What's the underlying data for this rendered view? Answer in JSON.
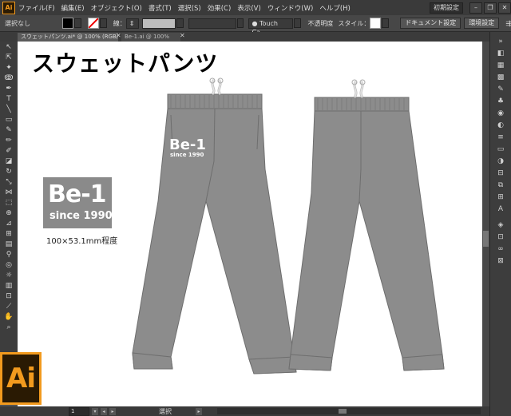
{
  "app": {
    "badge": "Ai",
    "workspace": "初期設定"
  },
  "menu": [
    "ファイル(F)",
    "編集(E)",
    "オブジェクト(O)",
    "書式(T)",
    "選択(S)",
    "効果(C)",
    "表示(V)",
    "ウィンドウ(W)",
    "ヘルプ(H)"
  ],
  "control": {
    "selection_label": "選択なし",
    "stroke_label": "線：",
    "brush_label": "Touch Ca...",
    "opacity_label": "不透明度",
    "style_label": "スタイル：",
    "doc_settings": "ドキュメント設定",
    "prefs": "環境設定"
  },
  "tabs": {
    "active": "スウェットパンツ.ai* @ 100% (RGB/プレビュー)",
    "inactive": "Be-1.ai @ 100%"
  },
  "canvas": {
    "title": "スウェットパンツ",
    "print_text": "Be-1",
    "print_sub": "since 1990",
    "logo_main": "Be-1",
    "logo_sub": "since 1990",
    "dimension": "100×53.1mm程度"
  },
  "status": {
    "zoom": "1",
    "mode": "選択"
  },
  "colors": {
    "accent": "#f29a1e",
    "pants": "#8c8c8c",
    "pants_outline": "#6e6e6e"
  },
  "tools": [
    "selection-icon",
    "direct-selection-icon",
    "magic-wand-icon",
    "lasso-icon",
    "pen-icon",
    "type-icon",
    "line-icon",
    "rectangle-icon",
    "paintbrush-icon",
    "pencil-icon",
    "blob-brush-icon",
    "eraser-icon",
    "rotate-icon",
    "scale-icon",
    "width-icon",
    "free-transform-icon",
    "shape-builder-icon",
    "perspective-icon",
    "mesh-icon",
    "gradient-icon",
    "eyedropper-icon",
    "blend-icon",
    "symbol-sprayer-icon",
    "column-graph-icon",
    "artboard-icon",
    "slice-icon",
    "hand-icon",
    "zoom-icon"
  ],
  "panels": [
    "color-icon",
    "color-guide-icon",
    "swatches-icon",
    "brushes-icon",
    "symbols-icon",
    "graphic-styles-icon",
    "appearance-icon",
    "stroke-icon",
    "gradient-panel-icon",
    "transparency-icon",
    "align-icon",
    "pathfinder-icon",
    "transform-icon",
    "character-icon",
    "layers-icon",
    "artboards-icon",
    "links-icon",
    "navigator-icon"
  ]
}
